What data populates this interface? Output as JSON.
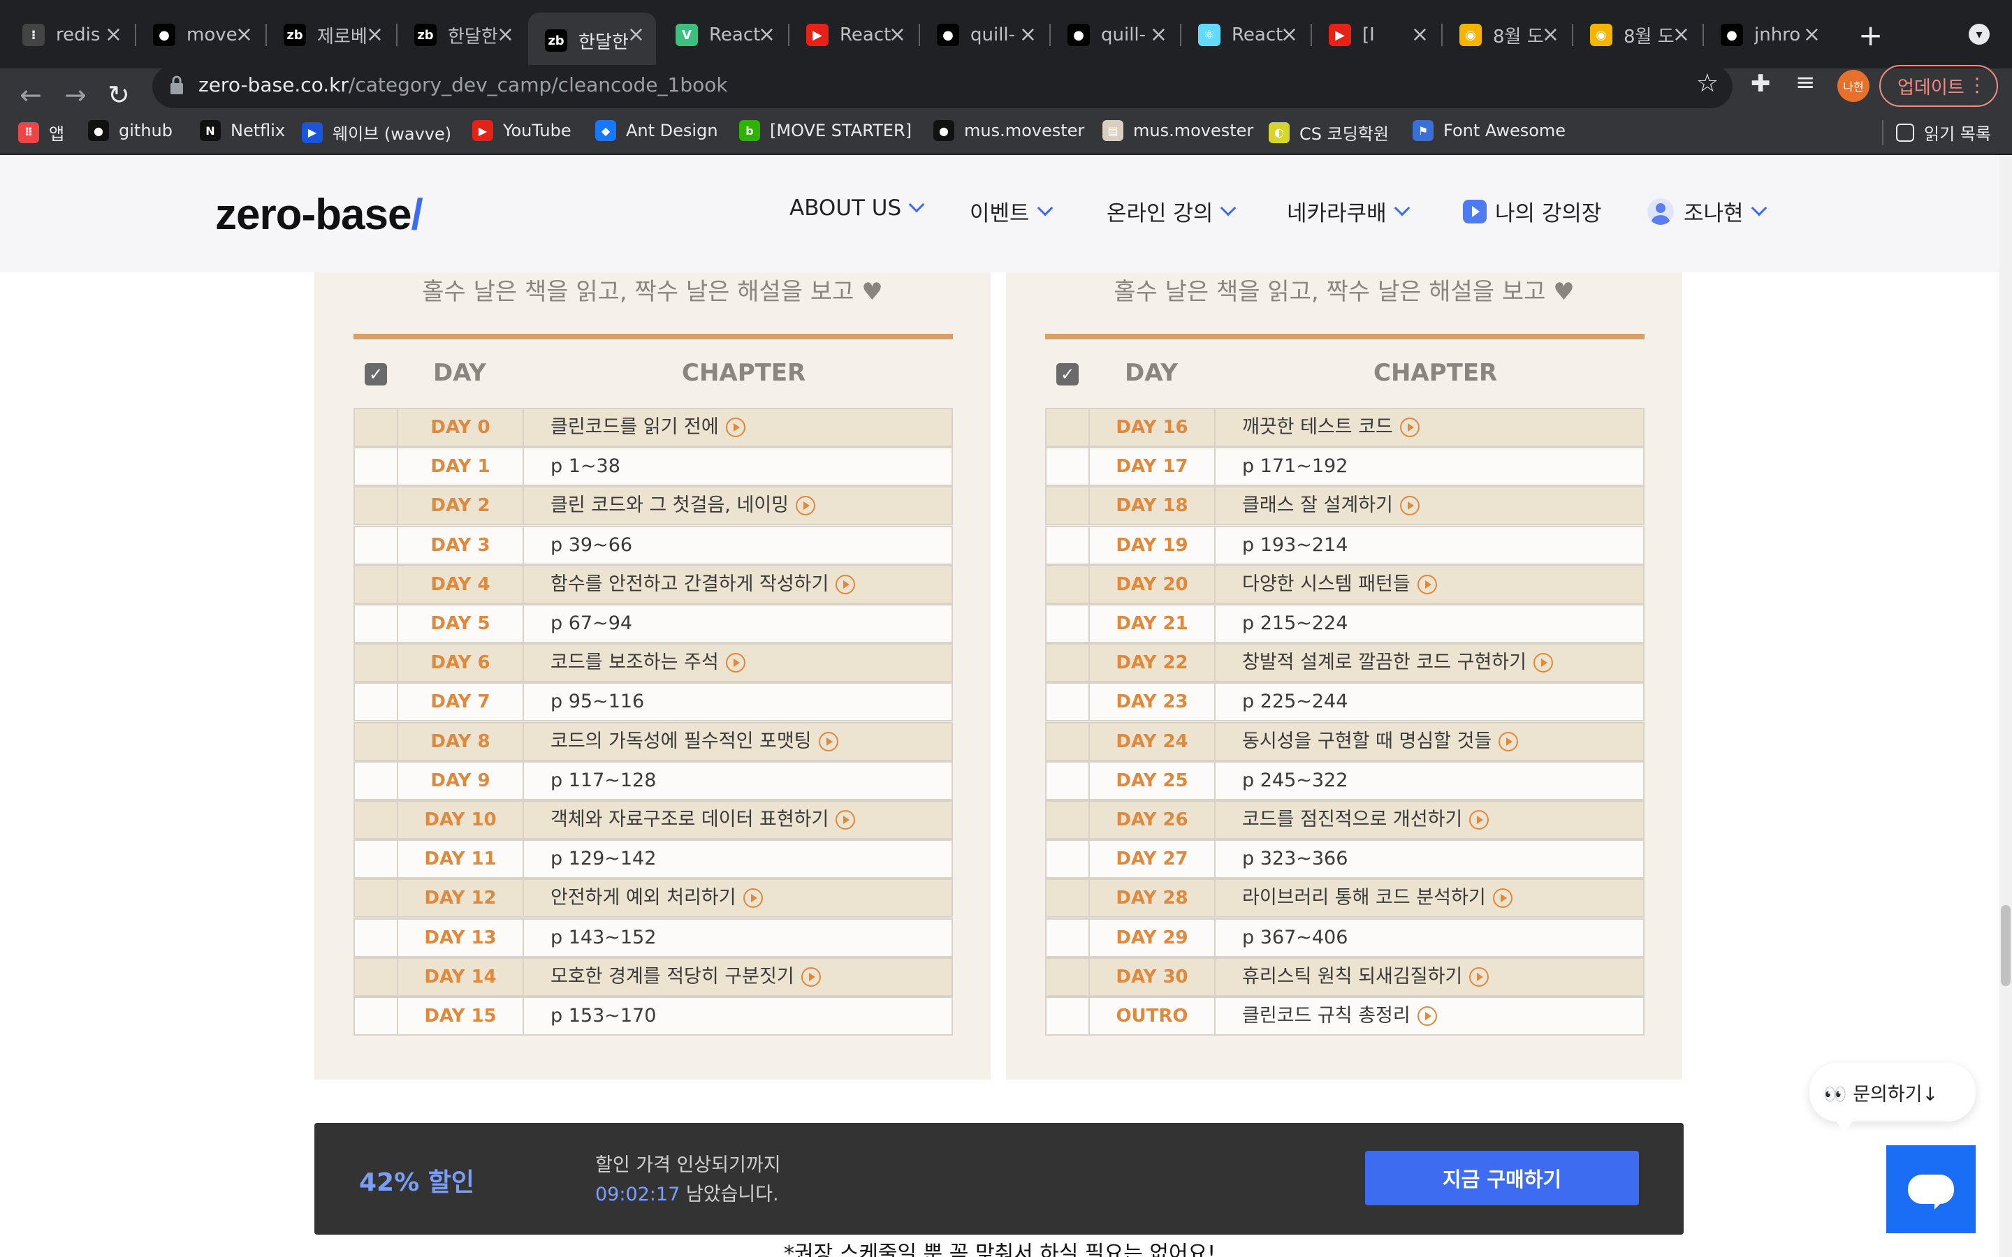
{
  "browser": {
    "tabs": [
      {
        "label": "redis",
        "icon": "redis-icon",
        "color": "#444"
      },
      {
        "label": "move",
        "icon": "github-icon",
        "color": "#000"
      },
      {
        "label": "제로베",
        "icon": "zb-icon",
        "color": "#000"
      },
      {
        "label": "한달한",
        "icon": "zb-icon",
        "color": "#000"
      },
      {
        "label": "한달한",
        "icon": "zb-icon",
        "color": "#000",
        "active": true
      },
      {
        "label": "React",
        "icon": "vue-v-icon",
        "color": "#3dbf7f"
      },
      {
        "label": "React",
        "icon": "youtube-icon",
        "color": "#e62117"
      },
      {
        "label": "quill-",
        "icon": "github-icon",
        "color": "#000"
      },
      {
        "label": "quill-",
        "icon": "github-icon",
        "color": "#000"
      },
      {
        "label": "React",
        "icon": "react-icon",
        "color": "#61dafb"
      },
      {
        "label": "[I",
        "icon": "youtube-icon",
        "color": "#e62117"
      },
      {
        "label": "8월 도",
        "icon": "chick-icon",
        "color": "#f4b400"
      },
      {
        "label": "8월 도",
        "icon": "chick-icon",
        "color": "#f4b400"
      },
      {
        "label": "jnhro",
        "icon": "github-icon",
        "color": "#000"
      }
    ],
    "url_domain": "zero-base.co.kr",
    "url_path": "/category_dev_camp/cleancode_1book",
    "profile_initials": "나현",
    "update_label": "업데이트",
    "bookmarks": [
      {
        "label": "앱",
        "icon": "apps-grid-icon"
      },
      {
        "label": "github",
        "icon": "github-icon"
      },
      {
        "label": "Netflix",
        "icon": "netflix-icon"
      },
      {
        "label": "웨이브 (wavve)",
        "icon": "wavve-icon"
      },
      {
        "label": "YouTube",
        "icon": "youtube-icon"
      },
      {
        "label": "Ant Design",
        "icon": "ant-design-icon"
      },
      {
        "label": "[MOVE STARTER]",
        "icon": "blog-icon"
      },
      {
        "label": "mus.movester",
        "icon": "github-icon"
      },
      {
        "label": "mus.movester",
        "icon": "document-icon"
      },
      {
        "label": "CS 코딩학원",
        "icon": "tennis-ball-icon"
      },
      {
        "label": "Font Awesome",
        "icon": "flag-icon"
      }
    ],
    "reading_list_label": "읽기 목록"
  },
  "site": {
    "logo_text": "zero-base",
    "logo_slash": "/",
    "nav": {
      "about": "ABOUT US",
      "events": "이벤트",
      "online": "온라인 강의",
      "nekarakubae": "네카라쿠배",
      "my_lectures": "나의 강의장",
      "user": "조나현"
    }
  },
  "schedule": {
    "subtitle": "홀수 날은 책을 읽고, 짝수 날은 해설을 보고 ♥",
    "header_day": "DAY",
    "header_chapter": "CHAPTER",
    "left": [
      {
        "day": "DAY 0",
        "chapter": "클린코드를 읽기 전에",
        "video": true
      },
      {
        "day": "DAY 1",
        "chapter": "p 1~38",
        "video": false
      },
      {
        "day": "DAY 2",
        "chapter": "클린 코드와 그 첫걸음, 네이밍",
        "video": true
      },
      {
        "day": "DAY 3",
        "chapter": "p 39~66",
        "video": false
      },
      {
        "day": "DAY 4",
        "chapter": "함수를 안전하고 간결하게 작성하기",
        "video": true
      },
      {
        "day": "DAY 5",
        "chapter": "p 67~94",
        "video": false
      },
      {
        "day": "DAY 6",
        "chapter": "코드를 보조하는 주석",
        "video": true
      },
      {
        "day": "DAY 7",
        "chapter": "p 95~116",
        "video": false
      },
      {
        "day": "DAY 8",
        "chapter": "코드의 가독성에 필수적인 포맷팅",
        "video": true
      },
      {
        "day": "DAY 9",
        "chapter": "p 117~128",
        "video": false
      },
      {
        "day": "DAY 10",
        "chapter": "객체와 자료구조로 데이터 표현하기",
        "video": true
      },
      {
        "day": "DAY 11",
        "chapter": "p 129~142",
        "video": false
      },
      {
        "day": "DAY 12",
        "chapter": "안전하게 예외 처리하기",
        "video": true
      },
      {
        "day": "DAY 13",
        "chapter": "p 143~152",
        "video": false
      },
      {
        "day": "DAY 14",
        "chapter": "모호한 경계를 적당히 구분짓기",
        "video": true
      },
      {
        "day": "DAY 15",
        "chapter": "p 153~170",
        "video": false
      }
    ],
    "right": [
      {
        "day": "DAY 16",
        "chapter": "깨끗한 테스트 코드",
        "video": true
      },
      {
        "day": "DAY 17",
        "chapter": "p 171~192",
        "video": false
      },
      {
        "day": "DAY 18",
        "chapter": "클래스 잘 설계하기",
        "video": true
      },
      {
        "day": "DAY 19",
        "chapter": "p 193~214",
        "video": false
      },
      {
        "day": "DAY 20",
        "chapter": "다양한 시스템 패턴들",
        "video": true
      },
      {
        "day": "DAY 21",
        "chapter": "p 215~224",
        "video": false
      },
      {
        "day": "DAY 22",
        "chapter": "창발적 설계로 깔끔한 코드 구현하기",
        "video": true
      },
      {
        "day": "DAY 23",
        "chapter": "p 225~244",
        "video": false
      },
      {
        "day": "DAY 24",
        "chapter": "동시성을 구현할 때 명심할 것들",
        "video": true
      },
      {
        "day": "DAY 25",
        "chapter": "p 245~322",
        "video": false
      },
      {
        "day": "DAY 26",
        "chapter": "코드를 점진적으로 개선하기",
        "video": true
      },
      {
        "day": "DAY 27",
        "chapter": "p 323~366",
        "video": false
      },
      {
        "day": "DAY 28",
        "chapter": "라이브러리 통해 코드 분석하기",
        "video": true
      },
      {
        "day": "DAY 29",
        "chapter": "p 367~406",
        "video": false
      },
      {
        "day": "DAY 30",
        "chapter": "휴리스틱 원칙 되새김질하기",
        "video": true
      },
      {
        "day": "OUTRO",
        "chapter": "클린코드 규칙 총정리",
        "video": true
      }
    ]
  },
  "purchase": {
    "discount": "42% 할인",
    "line1": "할인 가격 인상되기까지",
    "timer": "09:02:17",
    "line2_suffix": " 남았습니다.",
    "buy_label": "지금 구매하기"
  },
  "bottom_note": "*권장 스케줄일 뿐 꼭 맞춰서 하실 필요는 없어요!",
  "chat": {
    "inquiry": "👀 문의하기↓"
  },
  "colors": {
    "accent_blue": "#3e6cf0",
    "day_orange": "#dd8a3e",
    "panel_bg": "#f5f1ea"
  }
}
